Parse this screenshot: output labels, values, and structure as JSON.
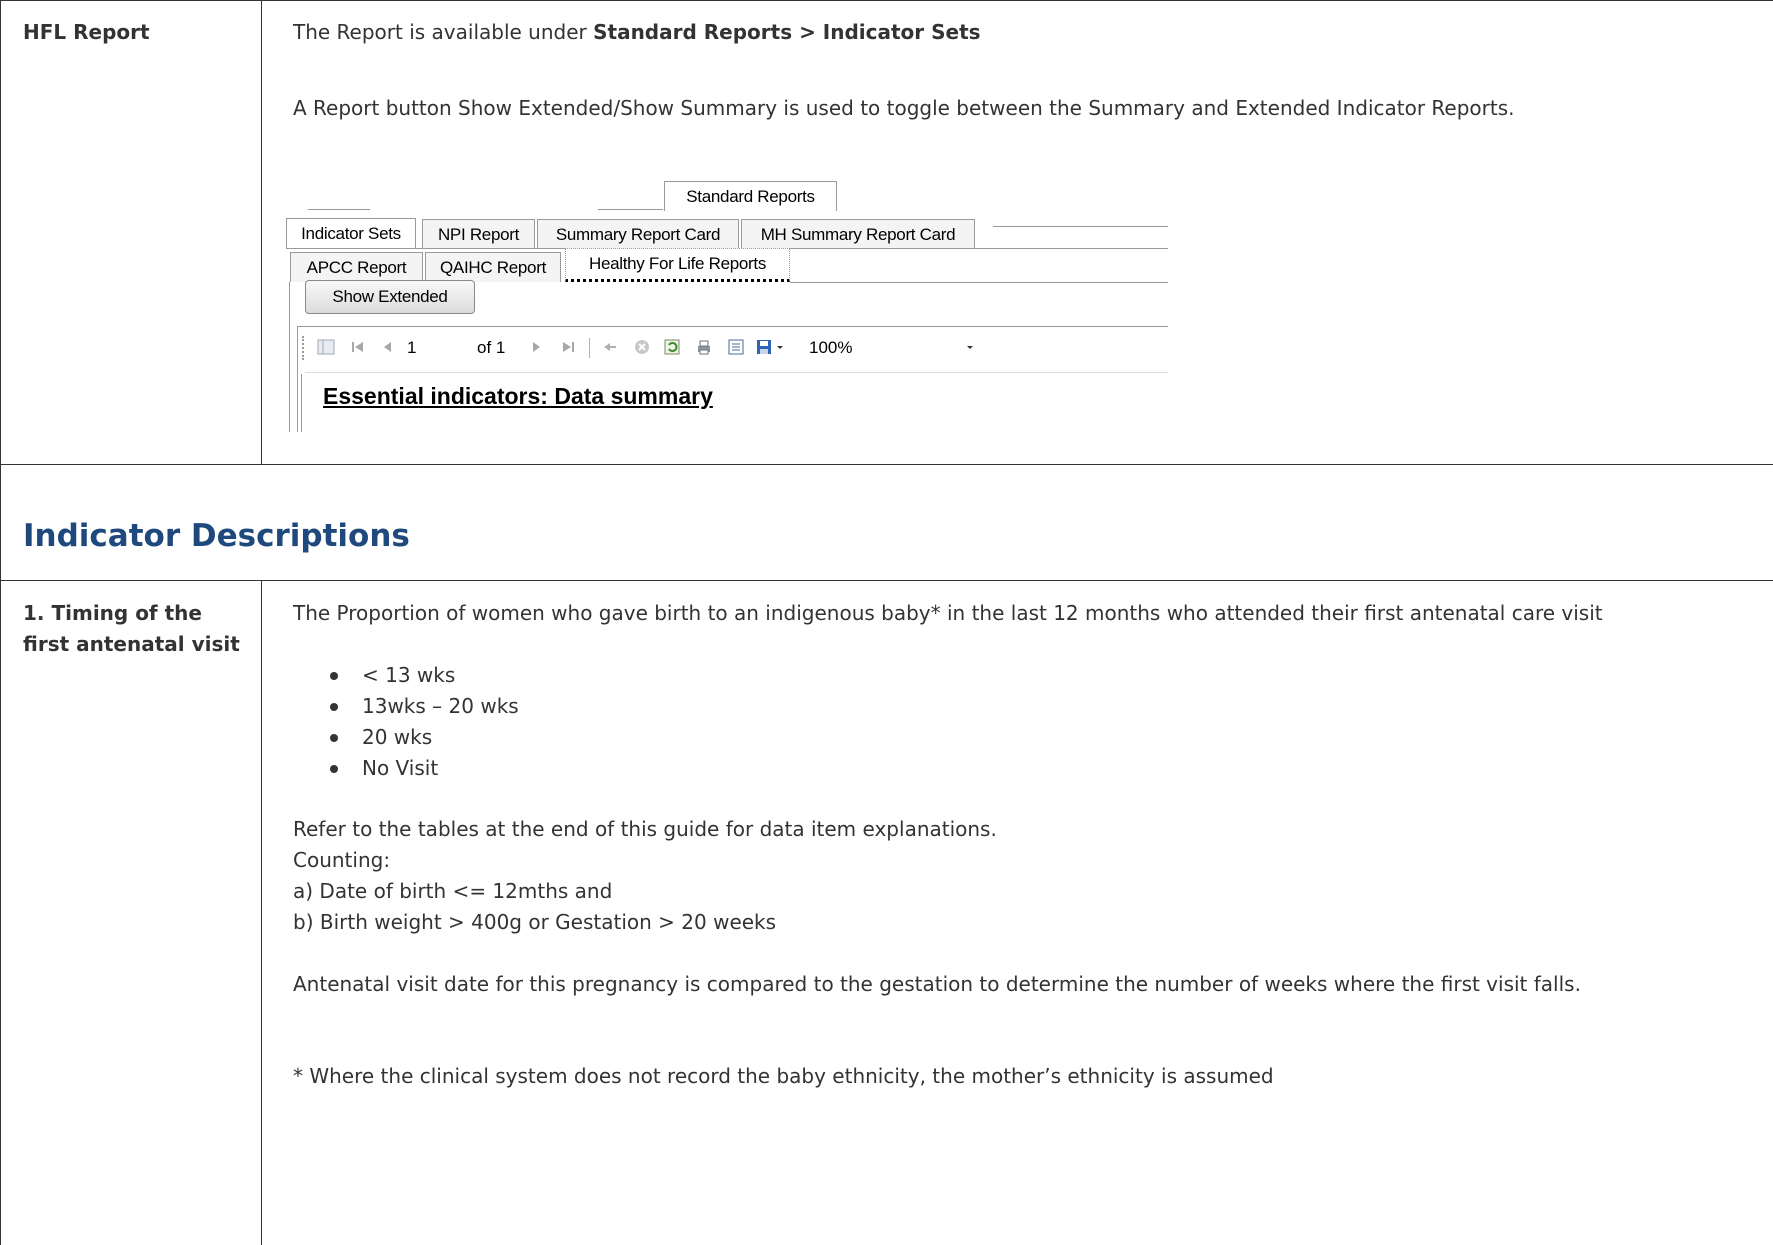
{
  "row1": {
    "label": "HFL Report",
    "line1_prefix": "The Report is available under ",
    "line1_bold": "Standard Reports > Indicator Sets",
    "line2": "A Report button Show Extended/Show Summary is used to toggle between the Summary and Extended Indicator Reports."
  },
  "screenshot": {
    "top_tab": "Standard Reports",
    "tabs_row1": [
      "Indicator Sets",
      "NPI Report",
      "Summary Report Card",
      "MH Summary Report Card"
    ],
    "tabs_row2": [
      "APCC Report",
      "QAIHC Report",
      "Healthy For Life Reports"
    ],
    "button": "Show Extended",
    "toolbar": {
      "page_number": "1",
      "page_of": "of 1",
      "zoom": "100%",
      "icons": [
        "toggle-sidebar-icon",
        "first-page-icon",
        "prev-page-icon",
        "next-page-icon",
        "last-page-icon",
        "back-icon",
        "stop-icon",
        "refresh-icon",
        "print-icon",
        "page-setup-icon",
        "save-icon",
        "zoom-dropdown-icon"
      ]
    },
    "report_title": "Essential indicators: Data summary"
  },
  "section_heading": "Indicator Descriptions",
  "indicator1": {
    "label": "1. Timing of the first antenatal visit",
    "intro": "The Proportion of women who gave birth to an indigenous baby* in the last 12 months who attended their first antenatal care visit",
    "bullets": [
      "< 13 wks",
      "13wks – 20 wks",
      "20 wks",
      "No Visit"
    ],
    "refer": "Refer to the tables at the end of this guide for data item explanations.",
    "counting": "Counting:",
    "count_a": "a) Date of birth <= 12mths and",
    "count_b": "b) Birth weight > 400g or Gestation > 20 weeks",
    "antenatal": "Antenatal visit date for this pregnancy is compared to the gestation to determine the number of weeks where the first visit falls.",
    "footnote": "* Where the clinical system does not record the baby ethnicity, the mother’s ethnicity is assumed"
  }
}
